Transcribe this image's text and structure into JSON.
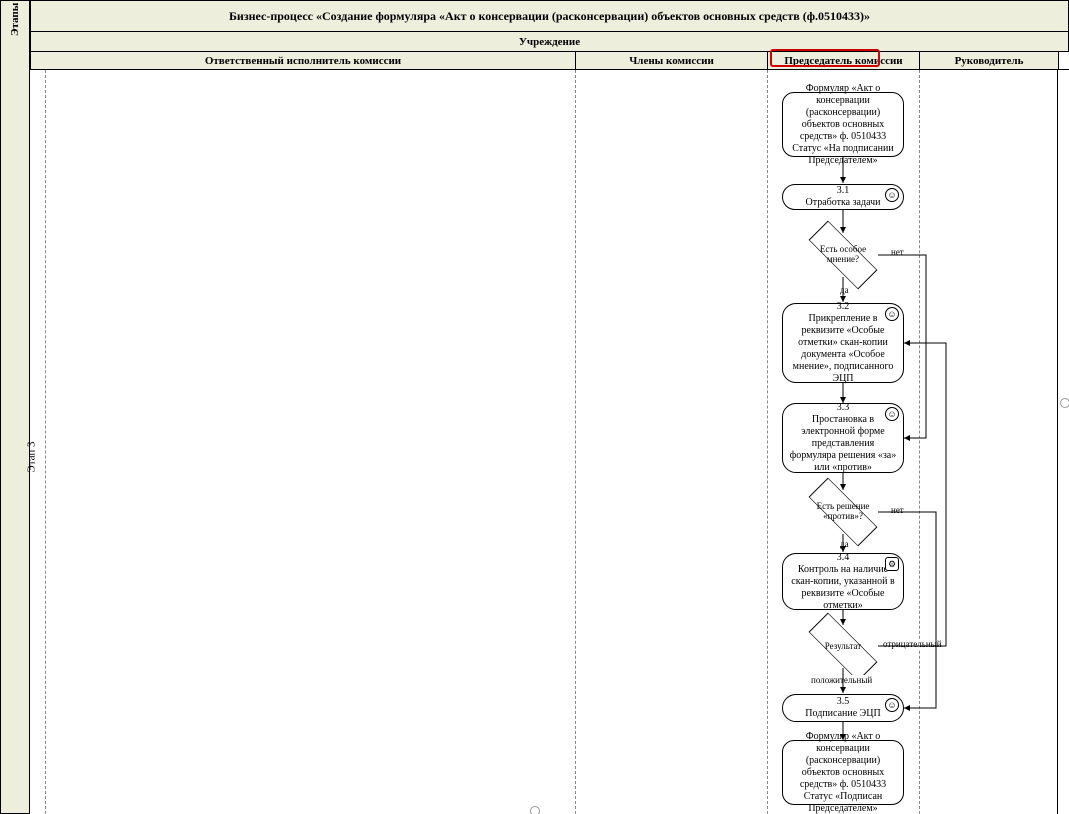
{
  "title": "Бизнес-процесс «Создание формуляра «Акт о консервации (расконсервации) объектов основных средств (ф.0510433)»",
  "org": "Учреждение",
  "stages_label": "Этапы",
  "stage3": "Этап 3",
  "columns": {
    "c1": "Ответственный исполнитель комиссии",
    "c2": "Члены комиссии",
    "c3": "Председатель комиссии",
    "c4": "Руководитель"
  },
  "nodes": {
    "n_in": "Формуляр «Акт о консервации (расконсервации) объектов основных средств» ф. 0510433 Статус «На подписании Председателем»",
    "n31_num": "3.1",
    "n31_txt": "Отработка задачи",
    "d1": "Есть особое мнение?",
    "n32_num": "3.2",
    "n32_txt": "Прикрепление в реквизите «Особые отметки» скан-копии документа «Особое мнение», подписанного ЭЦП",
    "n33_num": "3.3",
    "n33_txt": "Простановка в электронной форме представления формуляра решения «за» или «против»",
    "d2": "Есть решение «против»?",
    "n34_num": "3.4",
    "n34_txt": "Контроль на наличие скан-копии, указанной в реквизите «Особые отметки»",
    "d3": "Результат",
    "n35_num": "3.5",
    "n35_txt": "Подписание ЭЦП",
    "n_out": "Формуляр «Акт о консервации (расконсервации) объектов основных средств» ф. 0510433 Статус «Подписан Председателем»"
  },
  "labels": {
    "yes": "да",
    "no": "нет",
    "neg": "отрицательный",
    "pos": "положительный"
  }
}
